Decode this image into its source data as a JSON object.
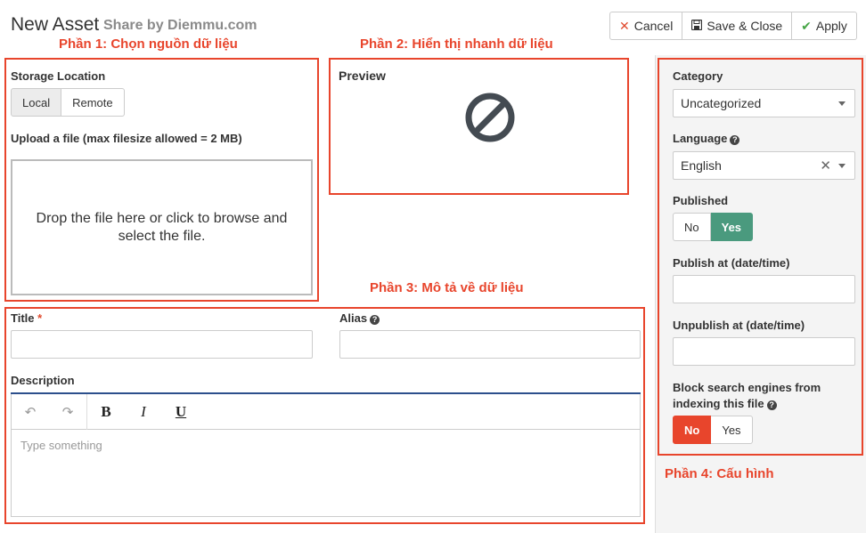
{
  "header": {
    "title": "New Asset",
    "watermark": "Share by Diemmu.com",
    "toolbar": {
      "cancel": "Cancel",
      "save_close": "Save & Close",
      "apply": "Apply"
    }
  },
  "annotations": {
    "part1": "Phần 1: Chọn nguồn dữ liệu",
    "part2": "Phần 2: Hiển thị nhanh dữ liệu",
    "part3": "Phần 3: Mô tả về dữ liệu",
    "part4": "Phần 4: Cấu hình"
  },
  "storage": {
    "label": "Storage Location",
    "options": [
      "Local",
      "Remote"
    ],
    "selected": "Local",
    "upload_label": "Upload a file (max filesize allowed = 2 MB)",
    "dropzone_text": "Drop the file here or click to browse and select the file."
  },
  "preview": {
    "label": "Preview",
    "icon": "no-preview-icon"
  },
  "details": {
    "title_label": "Title",
    "title_required": "*",
    "title_value": "",
    "alias_label": "Alias",
    "alias_value": "",
    "description_label": "Description",
    "description_placeholder": "Type something",
    "editor_buttons": [
      "undo",
      "redo",
      "B",
      "I",
      "U"
    ]
  },
  "config": {
    "category_label": "Category",
    "category_value": "Uncategorized",
    "language_label": "Language",
    "language_value": "English",
    "published_label": "Published",
    "published_options": [
      "No",
      "Yes"
    ],
    "published_selected": "Yes",
    "publish_at_label": "Publish at (date/time)",
    "publish_at_value": "",
    "unpublish_at_label": "Unpublish at (date/time)",
    "unpublish_at_value": "",
    "block_label_line1": "Block search engines from",
    "block_label_line2": "indexing this file",
    "block_options": [
      "No",
      "Yes"
    ],
    "block_selected": "No"
  },
  "colors": {
    "accent_red": "#e8452c",
    "published_green": "#4a9a7e",
    "editor_border_blue": "#2c4f8c"
  }
}
